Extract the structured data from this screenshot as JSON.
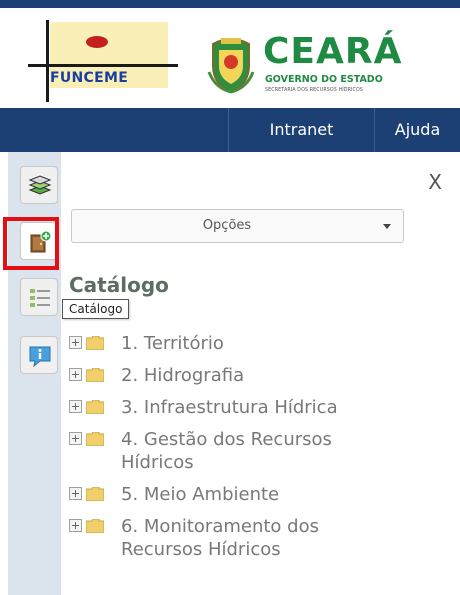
{
  "header": {
    "funceme_logo_text": "FUNCEME",
    "ceara_logo": {
      "title": "CEARÁ",
      "line1": "GOVERNO DO ESTADO",
      "line2": "SECRETARIA DOS RECURSOS HÍDRICOS"
    }
  },
  "nav": {
    "items": [
      {
        "label": "Intranet"
      },
      {
        "label": "Ajuda"
      }
    ]
  },
  "toolbar": {
    "buttons": [
      {
        "icon": "layers-icon"
      },
      {
        "icon": "add-catalog-icon",
        "tooltip": "Catálogo",
        "highlighted": true
      },
      {
        "icon": "legend-list-icon"
      },
      {
        "icon": "info-icon"
      }
    ]
  },
  "panel": {
    "close_label": "X",
    "options_select": {
      "value": "Opções"
    },
    "title": "Catálogo",
    "tree": [
      {
        "label": "1. Território"
      },
      {
        "label": "2. Hidrografia"
      },
      {
        "label": "3. Infraestrutura Hídrica"
      },
      {
        "label": "4. Gestão dos Recursos Hídricos"
      },
      {
        "label": "5. Meio Ambiente"
      },
      {
        "label": "6. Monitoramento dos Recursos Hídricos"
      }
    ]
  },
  "colors": {
    "nav_bg": "#1c3f74",
    "toolbar_bg": "#dbe3ed",
    "highlight_border": "#e30f14",
    "ceara_green": "#1e8a42"
  }
}
